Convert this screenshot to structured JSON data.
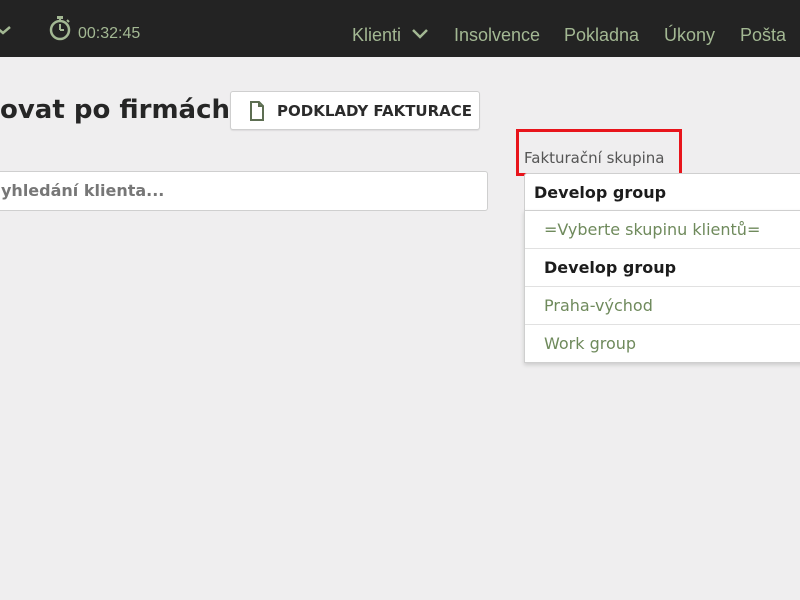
{
  "colors": {
    "navbar_bg": "#232323",
    "nav_text": "#a3b893",
    "page_bg": "#efeeef",
    "highlight": "#e8141b",
    "option_text": "#6f8a5c"
  },
  "navbar": {
    "timer_icon": "stopwatch-icon",
    "timer": "00:32:45",
    "items": [
      {
        "label": "Klienti",
        "has_dropdown": true
      },
      {
        "label": "Insolvence"
      },
      {
        "label": "Pokladna"
      },
      {
        "label": "Úkony"
      },
      {
        "label": "Pošta"
      }
    ]
  },
  "main": {
    "title": "ovat po firmách",
    "docs_button": {
      "label": "PODKLADY FAKTURACE",
      "icon": "document-icon"
    },
    "search": {
      "placeholder": "yhledání klienta..."
    }
  },
  "group_select": {
    "label": "Fakturační skupina",
    "selected": "Develop group",
    "options": [
      "=Vyberte skupinu klientů=",
      "Develop group",
      "Praha-východ",
      "Work group"
    ]
  }
}
